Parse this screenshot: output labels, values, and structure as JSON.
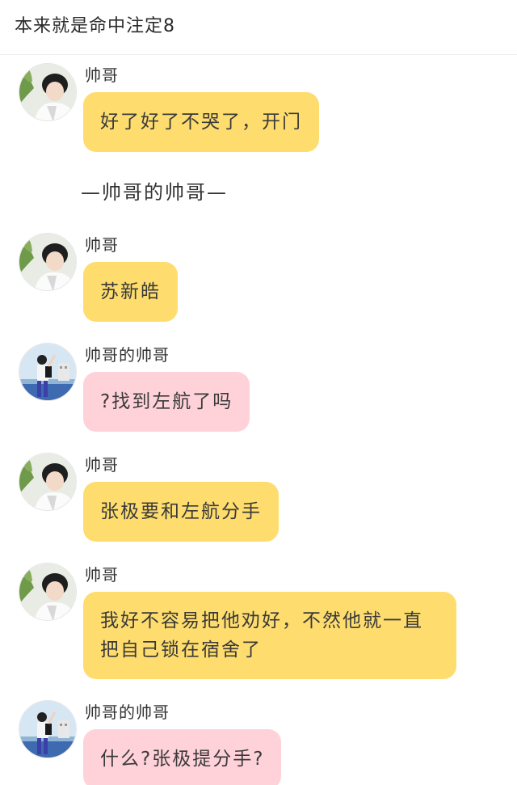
{
  "header": {
    "title": "本来就是命中注定8"
  },
  "divider": "—帅哥的帅哥—",
  "messages": [
    {
      "sender": "帅哥",
      "avatar": "avatar-a-icon",
      "text": "好了好了不哭了，开门",
      "color": "#fedd6e"
    },
    {
      "sender": "帅哥",
      "avatar": "avatar-a-icon",
      "text": "苏新皓",
      "color": "#fedd6e"
    },
    {
      "sender": "帅哥的帅哥",
      "avatar": "avatar-b-icon",
      "text": "?找到左航了吗",
      "color": "#ffd2d9"
    },
    {
      "sender": "帅哥",
      "avatar": "avatar-a-icon",
      "text": "张极要和左航分手",
      "color": "#fedd6e"
    },
    {
      "sender": "帅哥",
      "avatar": "avatar-a-icon",
      "text": "我好不容易把他劝好，不然他就一直把自己锁在宿舍了",
      "color": "#fedd6e"
    },
    {
      "sender": "帅哥的帅哥",
      "avatar": "avatar-b-icon",
      "text": "什么?张极提分手?",
      "color": "#ffd2d9"
    }
  ]
}
